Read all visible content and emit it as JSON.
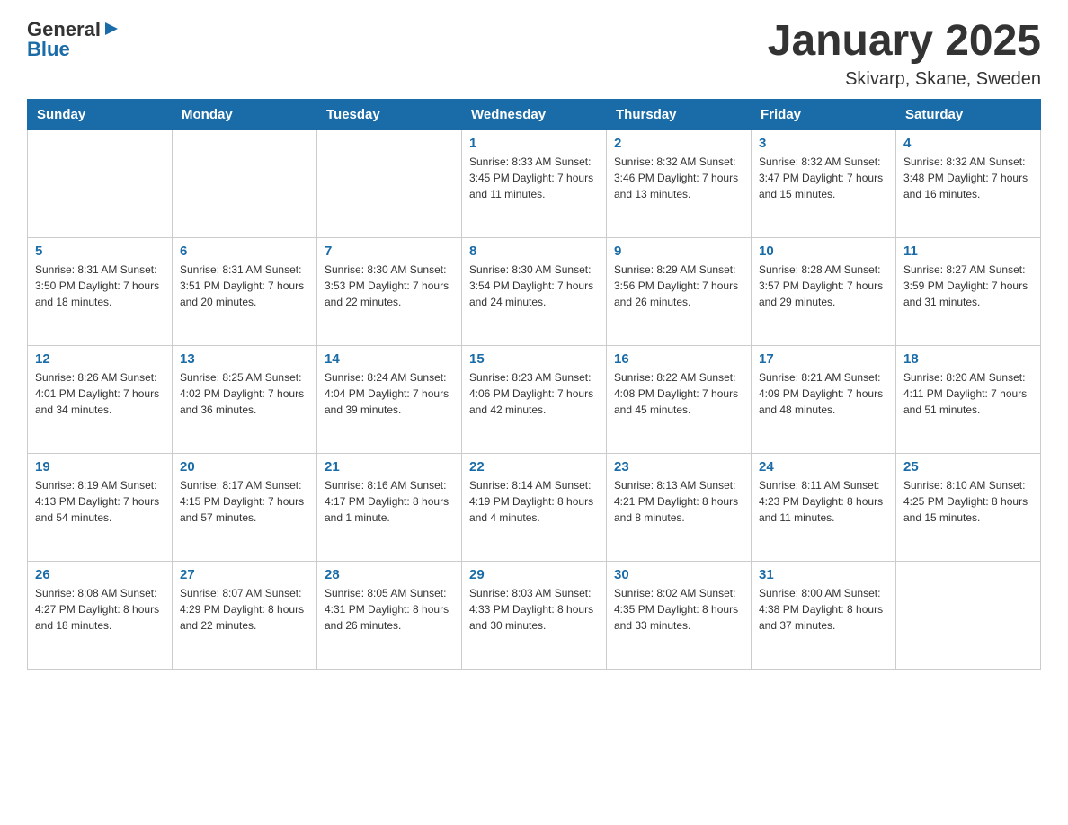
{
  "header": {
    "title": "January 2025",
    "subtitle": "Skivarp, Skane, Sweden",
    "logo_general": "General",
    "logo_blue": "Blue"
  },
  "calendar": {
    "days_of_week": [
      "Sunday",
      "Monday",
      "Tuesday",
      "Wednesday",
      "Thursday",
      "Friday",
      "Saturday"
    ],
    "weeks": [
      [
        {
          "day": "",
          "info": ""
        },
        {
          "day": "",
          "info": ""
        },
        {
          "day": "",
          "info": ""
        },
        {
          "day": "1",
          "info": "Sunrise: 8:33 AM\nSunset: 3:45 PM\nDaylight: 7 hours\nand 11 minutes."
        },
        {
          "day": "2",
          "info": "Sunrise: 8:32 AM\nSunset: 3:46 PM\nDaylight: 7 hours\nand 13 minutes."
        },
        {
          "day": "3",
          "info": "Sunrise: 8:32 AM\nSunset: 3:47 PM\nDaylight: 7 hours\nand 15 minutes."
        },
        {
          "day": "4",
          "info": "Sunrise: 8:32 AM\nSunset: 3:48 PM\nDaylight: 7 hours\nand 16 minutes."
        }
      ],
      [
        {
          "day": "5",
          "info": "Sunrise: 8:31 AM\nSunset: 3:50 PM\nDaylight: 7 hours\nand 18 minutes."
        },
        {
          "day": "6",
          "info": "Sunrise: 8:31 AM\nSunset: 3:51 PM\nDaylight: 7 hours\nand 20 minutes."
        },
        {
          "day": "7",
          "info": "Sunrise: 8:30 AM\nSunset: 3:53 PM\nDaylight: 7 hours\nand 22 minutes."
        },
        {
          "day": "8",
          "info": "Sunrise: 8:30 AM\nSunset: 3:54 PM\nDaylight: 7 hours\nand 24 minutes."
        },
        {
          "day": "9",
          "info": "Sunrise: 8:29 AM\nSunset: 3:56 PM\nDaylight: 7 hours\nand 26 minutes."
        },
        {
          "day": "10",
          "info": "Sunrise: 8:28 AM\nSunset: 3:57 PM\nDaylight: 7 hours\nand 29 minutes."
        },
        {
          "day": "11",
          "info": "Sunrise: 8:27 AM\nSunset: 3:59 PM\nDaylight: 7 hours\nand 31 minutes."
        }
      ],
      [
        {
          "day": "12",
          "info": "Sunrise: 8:26 AM\nSunset: 4:01 PM\nDaylight: 7 hours\nand 34 minutes."
        },
        {
          "day": "13",
          "info": "Sunrise: 8:25 AM\nSunset: 4:02 PM\nDaylight: 7 hours\nand 36 minutes."
        },
        {
          "day": "14",
          "info": "Sunrise: 8:24 AM\nSunset: 4:04 PM\nDaylight: 7 hours\nand 39 minutes."
        },
        {
          "day": "15",
          "info": "Sunrise: 8:23 AM\nSunset: 4:06 PM\nDaylight: 7 hours\nand 42 minutes."
        },
        {
          "day": "16",
          "info": "Sunrise: 8:22 AM\nSunset: 4:08 PM\nDaylight: 7 hours\nand 45 minutes."
        },
        {
          "day": "17",
          "info": "Sunrise: 8:21 AM\nSunset: 4:09 PM\nDaylight: 7 hours\nand 48 minutes."
        },
        {
          "day": "18",
          "info": "Sunrise: 8:20 AM\nSunset: 4:11 PM\nDaylight: 7 hours\nand 51 minutes."
        }
      ],
      [
        {
          "day": "19",
          "info": "Sunrise: 8:19 AM\nSunset: 4:13 PM\nDaylight: 7 hours\nand 54 minutes."
        },
        {
          "day": "20",
          "info": "Sunrise: 8:17 AM\nSunset: 4:15 PM\nDaylight: 7 hours\nand 57 minutes."
        },
        {
          "day": "21",
          "info": "Sunrise: 8:16 AM\nSunset: 4:17 PM\nDaylight: 8 hours\nand 1 minute."
        },
        {
          "day": "22",
          "info": "Sunrise: 8:14 AM\nSunset: 4:19 PM\nDaylight: 8 hours\nand 4 minutes."
        },
        {
          "day": "23",
          "info": "Sunrise: 8:13 AM\nSunset: 4:21 PM\nDaylight: 8 hours\nand 8 minutes."
        },
        {
          "day": "24",
          "info": "Sunrise: 8:11 AM\nSunset: 4:23 PM\nDaylight: 8 hours\nand 11 minutes."
        },
        {
          "day": "25",
          "info": "Sunrise: 8:10 AM\nSunset: 4:25 PM\nDaylight: 8 hours\nand 15 minutes."
        }
      ],
      [
        {
          "day": "26",
          "info": "Sunrise: 8:08 AM\nSunset: 4:27 PM\nDaylight: 8 hours\nand 18 minutes."
        },
        {
          "day": "27",
          "info": "Sunrise: 8:07 AM\nSunset: 4:29 PM\nDaylight: 8 hours\nand 22 minutes."
        },
        {
          "day": "28",
          "info": "Sunrise: 8:05 AM\nSunset: 4:31 PM\nDaylight: 8 hours\nand 26 minutes."
        },
        {
          "day": "29",
          "info": "Sunrise: 8:03 AM\nSunset: 4:33 PM\nDaylight: 8 hours\nand 30 minutes."
        },
        {
          "day": "30",
          "info": "Sunrise: 8:02 AM\nSunset: 4:35 PM\nDaylight: 8 hours\nand 33 minutes."
        },
        {
          "day": "31",
          "info": "Sunrise: 8:00 AM\nSunset: 4:38 PM\nDaylight: 8 hours\nand 37 minutes."
        },
        {
          "day": "",
          "info": ""
        }
      ]
    ]
  }
}
